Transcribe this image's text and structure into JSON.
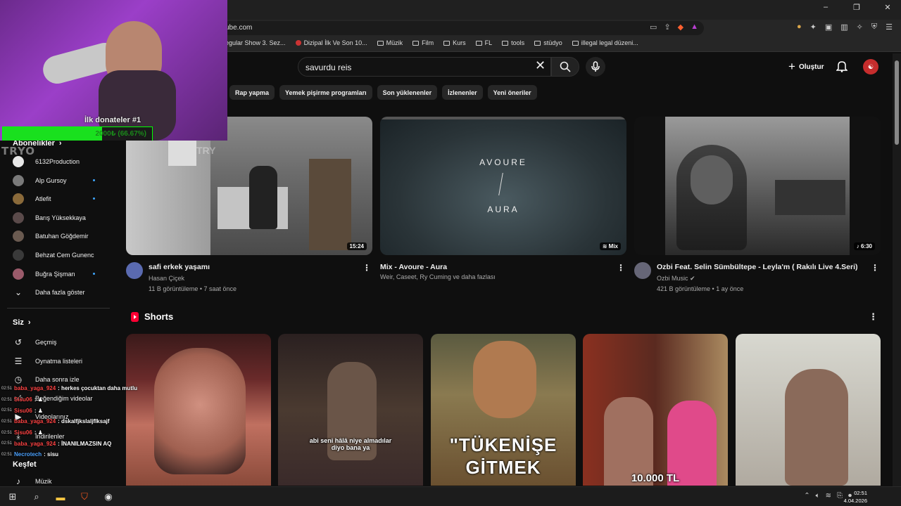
{
  "browser": {
    "url": "ube.com",
    "window_controls": [
      "–",
      "❐",
      "✕"
    ],
    "bookmarks": [
      {
        "label": "egular Show 3. Sez...",
        "icon": "page-icon"
      },
      {
        "label": "Dizipal İlk Ve Son 10...",
        "icon": "site-icon"
      },
      {
        "label": "Müzik",
        "icon": "folder-icon"
      },
      {
        "label": "Film",
        "icon": "folder-icon"
      },
      {
        "label": "Kurs",
        "icon": "folder-icon"
      },
      {
        "label": "FL",
        "icon": "folder-icon"
      },
      {
        "label": "tools",
        "icon": "folder-icon"
      },
      {
        "label": "stüdyo",
        "icon": "folder-icon"
      },
      {
        "label": "illegal legal düzeni...",
        "icon": "folder-icon"
      }
    ]
  },
  "header": {
    "search_value": "savurdu reis",
    "create_label": "Oluştur",
    "avatar_text": "☯"
  },
  "chips": [
    "Rap yapma",
    "Yemek pişirme programları",
    "Son yüklenenler",
    "İzlenenler",
    "Yeni öneriler"
  ],
  "sidebar": {
    "subscriptions_label": "Abonelikler",
    "subscriptions": [
      {
        "name": "6132Production",
        "color": "#e8e8e8",
        "dot": false
      },
      {
        "name": "Alp Gursoy",
        "color": "#7a7a7a",
        "dot": true
      },
      {
        "name": "Atlefit",
        "color": "#8a6a3a",
        "dot": true
      },
      {
        "name": "Barış Yüksekkaya",
        "color": "#5a4a4a",
        "dot": false
      },
      {
        "name": "Batuhan Göğdemir",
        "color": "#6a5a50",
        "dot": false
      },
      {
        "name": "Behzat Cem Gunenc",
        "color": "#3a3a3a",
        "dot": false
      },
      {
        "name": "Buğra Şişman",
        "color": "#9a5a6a",
        "dot": true
      }
    ],
    "show_more": "Daha fazla göster",
    "you_label": "Siz",
    "you_items": [
      {
        "label": "Geçmiş",
        "icon": "history-icon"
      },
      {
        "label": "Oynatma listeleri",
        "icon": "playlist-icon"
      },
      {
        "label": "Daha sonra izle",
        "icon": "clock-icon"
      },
      {
        "label": "Beğendiğim videolar",
        "icon": "like-icon"
      },
      {
        "label": "Videolarınız",
        "icon": "video-icon"
      },
      {
        "label": "İndirilenler",
        "icon": "download-icon"
      }
    ],
    "explore_label": "Keşfet",
    "explore_items": [
      {
        "label": "Müzik",
        "icon": "music-icon"
      }
    ]
  },
  "videos": [
    {
      "title": "safi erkek yaşamı",
      "channel": "Hasan Çiçek",
      "stats": "11 B görüntüleme • 7 saat önce",
      "duration": "15:24",
      "verified": false
    },
    {
      "title": "Mix - Avoure - Aura",
      "channel": "Weir, Caseet, Ry Cuming ve daha fazlası",
      "stats": "",
      "duration": "Mix",
      "thumb_line1": "AVOURE",
      "thumb_line2": "AURA",
      "verified": false
    },
    {
      "title": "Ozbi Feat. Selin Sümbültepe - Leyla'm ( Rakılı Live 4.Seri)",
      "channel": "Ozbi Music",
      "stats": "421 B görüntüleme • 1 ay önce",
      "duration": "6:30",
      "verified": true
    }
  ],
  "shorts": {
    "title": "Shorts",
    "items": [
      {
        "caption": ""
      },
      {
        "caption": "abi seni hâlâ niye almadılar\ndiyo bana ya"
      },
      {
        "caption": "\"TÜKENİŞE\nGİTMEK"
      },
      {
        "caption": "10.000 TL"
      },
      {
        "caption": ""
      }
    ]
  },
  "stream_overlay": {
    "donor_label": "İlk donateler #1",
    "donor_progress": 0.667,
    "donor_text": "2000₺ (66.67%)",
    "watermark": "TRYO"
  },
  "chat": [
    {
      "time": "02:51",
      "user": "baba_yaga_924",
      "color": "#ff4444",
      "msg": ": herkes çocuktan daha mutlu"
    },
    {
      "time": "02:51",
      "user": "Sisu06",
      "color": "#ff4444",
      "msg": ": ♟"
    },
    {
      "time": "02:51",
      "user": "Sisu06",
      "color": "#ff4444",
      "msg": ": ♟"
    },
    {
      "time": "02:51",
      "user": "baba_yaga_924",
      "color": "#ff4444",
      "msg": ": dskalfjkslaljflksajf"
    },
    {
      "time": "02:51",
      "user": "Sisu06",
      "color": "#ff4444",
      "msg": ": ♟"
    },
    {
      "time": "02:51",
      "user": "baba_yaga_924",
      "color": "#ff4444",
      "msg": ": İNANILMAZSIN AQ"
    },
    {
      "time": "02:51",
      "user": "Necrotech",
      "color": "#4ea3ff",
      "msg": ": sisu"
    }
  ],
  "taskbar": {
    "time": "02:51",
    "date": "4.04.2026"
  }
}
